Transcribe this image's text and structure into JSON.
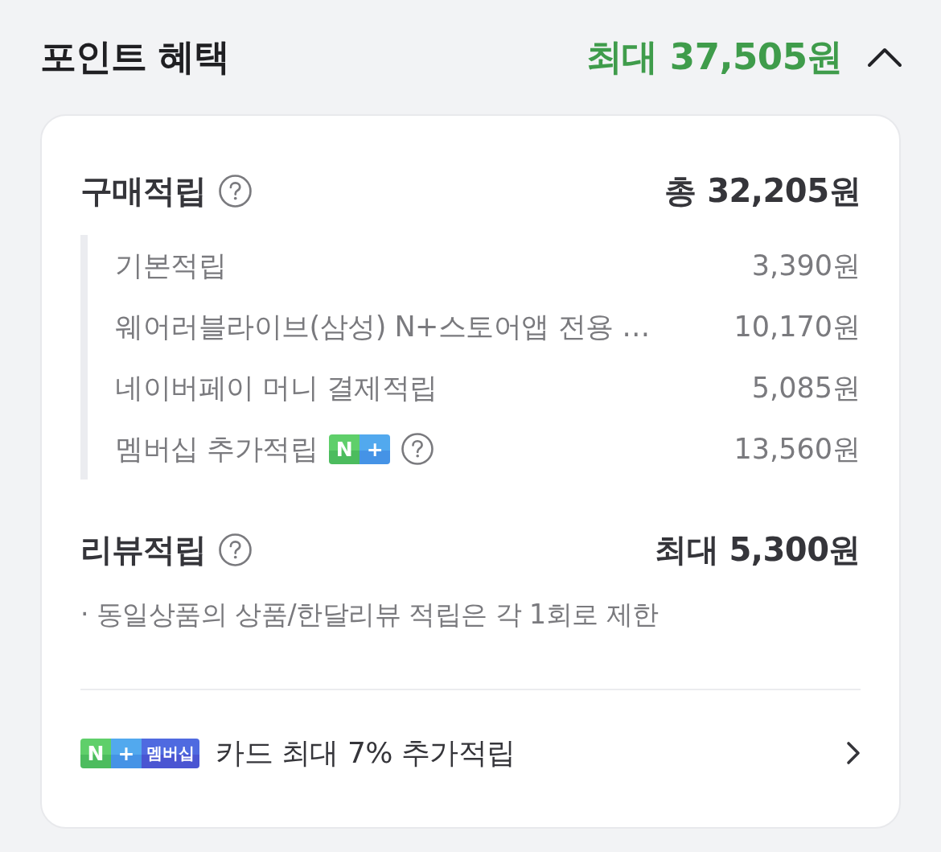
{
  "header": {
    "title": "포인트 혜택",
    "total": "최대 37,505원",
    "expanded": true
  },
  "purchase": {
    "title": "구매적립",
    "total": "총 32,205원",
    "items": [
      {
        "kind": "plain",
        "label": "기본적립",
        "amount": "3,390원"
      },
      {
        "kind": "plain",
        "label": "웨어러블라이브(삼성) N+스토어앱 전용 …",
        "amount": "10,170원"
      },
      {
        "kind": "plain",
        "label": "네이버페이 머니 결제적립",
        "amount": "5,085원"
      },
      {
        "kind": "membership",
        "label": "멤버십 추가적립",
        "amount": "13,560원",
        "badge": {
          "letter": "N",
          "sign": "+"
        }
      }
    ]
  },
  "review": {
    "title": "리뷰적립",
    "total": "최대 5,300원",
    "note": "· 동일상품의 상품/한달리뷰 적립은 각 1회로 제한"
  },
  "promo": {
    "badge": {
      "letter": "N",
      "sign": "+",
      "label": "멤버십"
    },
    "text": "카드 최대 7% 추가적립"
  }
}
